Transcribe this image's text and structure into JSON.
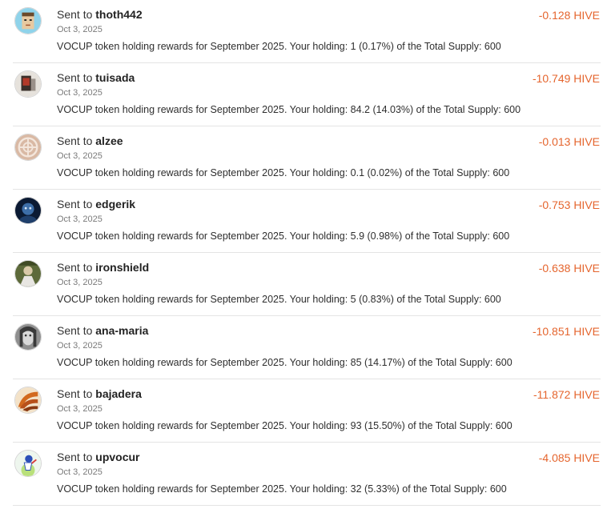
{
  "transfers": [
    {
      "prefix": "Sent to",
      "user": "thoth442",
      "date": "Oct 3, 2025",
      "memo": "VOCUP token holding rewards for September 2025. Your holding: 1 (0.17%) of the Total Supply: 600",
      "amount": "-0.128 HIVE",
      "avatar_icon": "cartoon-face-avatar-icon"
    },
    {
      "prefix": "Sent to",
      "user": "tuisada",
      "date": "Oct 3, 2025",
      "memo": "VOCUP token holding rewards for September 2025. Your holding: 84.2 (14.03%) of the Total Supply: 600",
      "amount": "-10.749 HIVE",
      "avatar_icon": "photo-avatar-icon"
    },
    {
      "prefix": "Sent to",
      "user": "alzee",
      "date": "Oct 3, 2025",
      "memo": "VOCUP token holding rewards for September 2025. Your holding: 0.1 (0.02%) of the Total Supply: 600",
      "amount": "-0.013 HIVE",
      "avatar_icon": "knot-avatar-icon"
    },
    {
      "prefix": "Sent to",
      "user": "edgerik",
      "date": "Oct 3, 2025",
      "memo": "VOCUP token holding rewards for September 2025. Your holding: 5.9 (0.98%) of the Total Supply: 600",
      "amount": "-0.753 HIVE",
      "avatar_icon": "dark-portrait-avatar-icon"
    },
    {
      "prefix": "Sent to",
      "user": "ironshield",
      "date": "Oct 3, 2025",
      "memo": "VOCUP token holding rewards for September 2025. Your holding: 5 (0.83%) of the Total Supply: 600",
      "amount": "-0.638 HIVE",
      "avatar_icon": "green-photo-avatar-icon"
    },
    {
      "prefix": "Sent to",
      "user": "ana-maria",
      "date": "Oct 3, 2025",
      "memo": "VOCUP token holding rewards for September 2025. Your holding: 85 (14.17%) of the Total Supply: 600",
      "amount": "-10.851 HIVE",
      "avatar_icon": "grayscale-face-avatar-icon"
    },
    {
      "prefix": "Sent to",
      "user": "bajadera",
      "date": "Oct 3, 2025",
      "memo": "VOCUP token holding rewards for September 2025. Your holding: 93 (15.50%) of the Total Supply: 600",
      "amount": "-11.872 HIVE",
      "avatar_icon": "orange-fan-avatar-icon"
    },
    {
      "prefix": "Sent to",
      "user": "upvocur",
      "date": "Oct 3, 2025",
      "memo": "VOCUP token holding rewards for September 2025. Your holding: 32 (5.33%) of the Total Supply: 600",
      "amount": "-4.085 HIVE",
      "avatar_icon": "mascot-avatar-icon"
    }
  ],
  "colors": {
    "amount": "#e5652e",
    "divider": "#e4e4e4",
    "date": "#7a7a7a"
  }
}
